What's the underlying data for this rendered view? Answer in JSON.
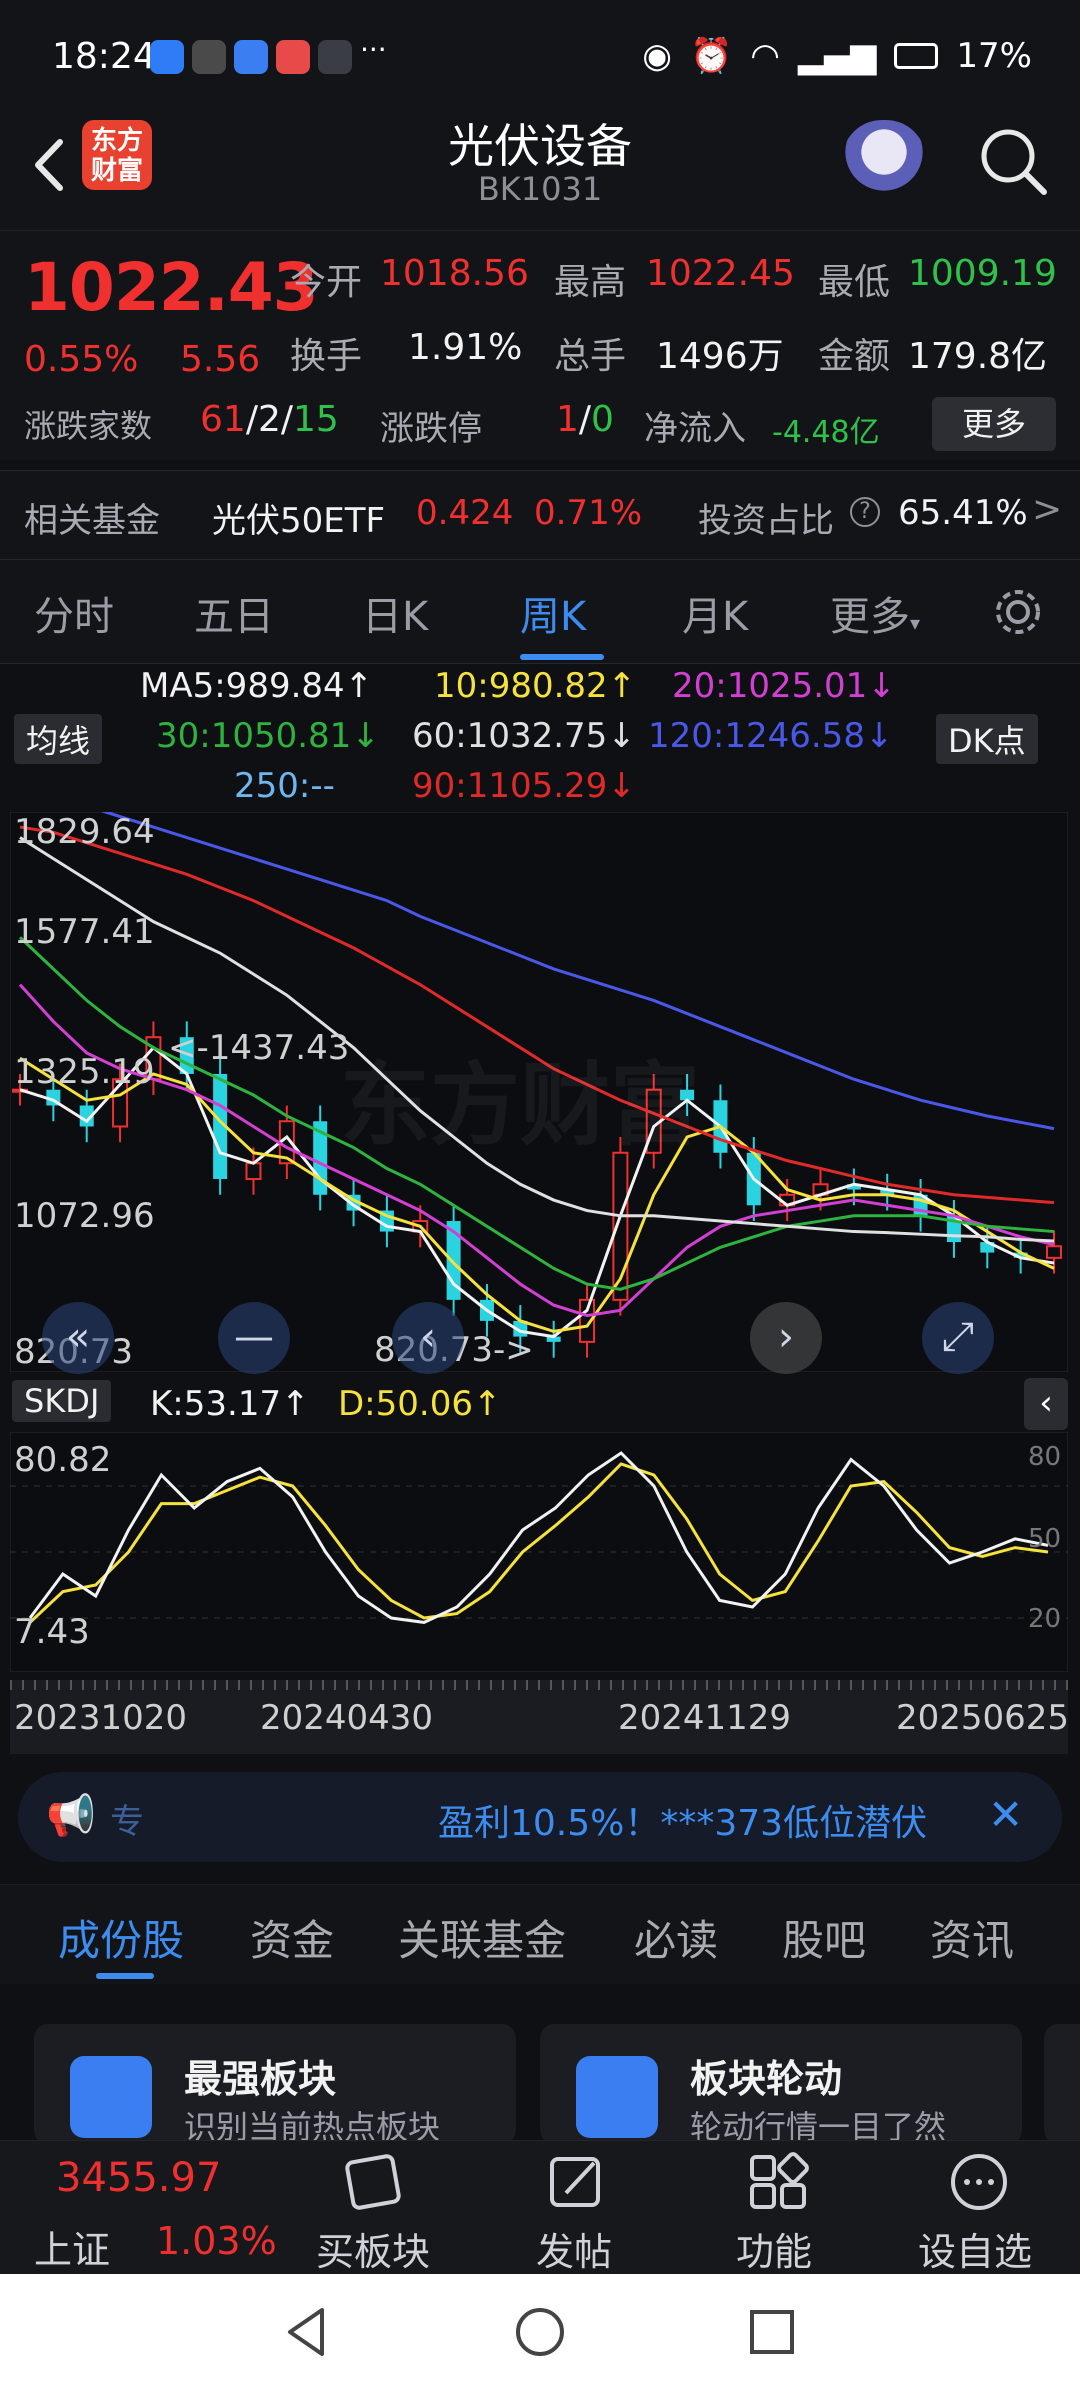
{
  "status_bar": {
    "time": "18:24",
    "right_text": "17%",
    "app_icon_colors": [
      "#2f7df6",
      "#4a4a4a",
      "#3a7ef2",
      "#e84a4a",
      "#3a3d45"
    ]
  },
  "header": {
    "logo_text": "东方财富",
    "title": "光伏设备",
    "code": "BK1031",
    "icons": [
      "back-icon",
      "robot-avatar",
      "search-icon"
    ]
  },
  "quote": {
    "price": "1022.43",
    "change_pct": "0.55%",
    "change_abs": "5.56",
    "open_label": "今开",
    "open_value": "1018.56",
    "high_label": "最高",
    "high_value": "1022.45",
    "low_label": "最低",
    "low_value": "1009.19",
    "turnover_label": "换手",
    "turnover_value": "1.91%",
    "volume_label": "总手",
    "volume_value": "1496万",
    "amount_label": "金额",
    "amount_value": "179.8亿",
    "updown_label": "涨跌家数",
    "up_count": "61",
    "flat_count": "2",
    "down_count": "15",
    "limit_label": "涨跌停",
    "limit_up": "1",
    "limit_down": "0",
    "netflow_label": "净流入",
    "netflow_value": "-4.48亿",
    "more_button": "更多"
  },
  "fund": {
    "label": "相关基金",
    "name": "光伏50ETF",
    "price": "0.424",
    "pct": "0.71%",
    "ratio_label": "投资占比",
    "ratio_value": "65.41%"
  },
  "kline_tabs": [
    "分时",
    "五日",
    "日K",
    "周K",
    "月K",
    "更多"
  ],
  "kline_tab_active": "周K",
  "ma_legend": {
    "toggle": "均线",
    "dk": "DK点",
    "items": [
      {
        "text": "MA5:989.84↑",
        "color": "#f2f2f2"
      },
      {
        "text": "10:980.82↑",
        "color": "#f5e23c"
      },
      {
        "text": "20:1025.01↓",
        "color": "#d33fd2"
      },
      {
        "text": "30:1050.81↓",
        "color": "#2fb33f"
      },
      {
        "text": "60:1032.75↓",
        "color": "#e0e0e0"
      },
      {
        "text": "120:1246.58↓",
        "color": "#4a58e8"
      },
      {
        "text": "250:--",
        "color": "#6fb6ef"
      },
      {
        "text": "90:1105.29↓",
        "color": "#e02a2a"
      }
    ]
  },
  "main_chart": {
    "y_labels": [
      "1829.64",
      "1577.41",
      "1325.19",
      "1072.96",
      "820.73"
    ],
    "max_annotation": "<-1437.43",
    "min_annotation": "820.73->",
    "watermark": "东方财富"
  },
  "chart_data": {
    "type": "line",
    "x_tick_labels": [
      "20231020",
      "20240430",
      "20241129",
      "20250625"
    ],
    "ylim": [
      820.73,
      1829.64
    ],
    "series": [
      {
        "name": "MA5",
        "color": "#f2f2f2",
        "values": [
          1320,
          1300,
          1260,
          1330,
          1400,
          1350,
          1200,
          1180,
          1230,
          1150,
          1100,
          1060,
          1050,
          950,
          900,
          860,
          850,
          900,
          1080,
          1250,
          1300,
          1250,
          1150,
          1100,
          1120,
          1140,
          1130,
          1120,
          1080,
          1030,
          1000,
          990
        ]
      },
      {
        "name": "10",
        "color": "#f5e23c",
        "values": [
          1380,
          1340,
          1300,
          1310,
          1350,
          1330,
          1260,
          1200,
          1190,
          1150,
          1110,
          1080,
          1060,
          990,
          930,
          880,
          860,
          870,
          960,
          1120,
          1230,
          1250,
          1200,
          1130,
          1110,
          1120,
          1120,
          1110,
          1090,
          1050,
          1010,
          980
        ]
      },
      {
        "name": "20",
        "color": "#d33fd2",
        "values": [
          1520,
          1450,
          1390,
          1360,
          1340,
          1320,
          1290,
          1250,
          1210,
          1180,
          1150,
          1120,
          1090,
          1050,
          1000,
          950,
          910,
          890,
          900,
          960,
          1020,
          1060,
          1080,
          1090,
          1100,
          1110,
          1100,
          1090,
          1080,
          1060,
          1040,
          1025
        ]
      },
      {
        "name": "30",
        "color": "#2fb33f",
        "values": [
          1610,
          1550,
          1490,
          1440,
          1400,
          1370,
          1340,
          1310,
          1270,
          1240,
          1210,
          1170,
          1140,
          1100,
          1060,
          1020,
          980,
          950,
          940,
          960,
          990,
          1020,
          1040,
          1060,
          1070,
          1080,
          1080,
          1080,
          1070,
          1060,
          1055,
          1050
        ]
      },
      {
        "name": "60",
        "color": "#e0e0e0",
        "values": [
          1800,
          1760,
          1720,
          1680,
          1640,
          1610,
          1580,
          1540,
          1500,
          1450,
          1400,
          1340,
          1280,
          1230,
          1180,
          1140,
          1110,
          1090,
          1080,
          1080,
          1075,
          1070,
          1065,
          1060,
          1055,
          1050,
          1048,
          1045,
          1042,
          1040,
          1035,
          1032
        ]
      },
      {
        "name": "90",
        "color": "#e02a2a",
        "values": [
          1820,
          1810,
          1790,
          1770,
          1750,
          1730,
          1705,
          1680,
          1650,
          1620,
          1590,
          1555,
          1520,
          1480,
          1440,
          1400,
          1360,
          1330,
          1300,
          1275,
          1250,
          1225,
          1205,
          1185,
          1170,
          1155,
          1140,
          1130,
          1120,
          1115,
          1110,
          1105
        ]
      },
      {
        "name": "120",
        "color": "#4a58e8",
        "values": [
          1900,
          1880,
          1860,
          1840,
          1820,
          1800,
          1780,
          1760,
          1740,
          1720,
          1700,
          1680,
          1650,
          1625,
          1600,
          1575,
          1550,
          1530,
          1510,
          1490,
          1465,
          1440,
          1415,
          1390,
          1365,
          1340,
          1320,
          1300,
          1285,
          1270,
          1258,
          1246
        ]
      }
    ],
    "candles_close": [
      1320,
      1290,
      1250,
      1340,
      1420,
      1350,
      1150,
      1180,
      1260,
      1120,
      1090,
      1050,
      1070,
      920,
      880,
      850,
      840,
      920,
      1200,
      1320,
      1300,
      1200,
      1100,
      1120,
      1140,
      1130,
      1120,
      1080,
      1030,
      1010,
      1000,
      1022
    ]
  },
  "skdj": {
    "label": "SKDJ",
    "k_text": "K:53.17↑",
    "d_text": "D:50.06↑",
    "y_left_top": "80.82",
    "y_left_bottom": "7.43",
    "y_right": [
      "80",
      "50",
      "20"
    ],
    "k_values": [
      20,
      40,
      30,
      60,
      85,
      70,
      82,
      88,
      75,
      50,
      30,
      20,
      18,
      25,
      40,
      60,
      70,
      85,
      95,
      80,
      50,
      28,
      25,
      40,
      70,
      92,
      80,
      60,
      45,
      50,
      56,
      53
    ],
    "d_values": [
      18,
      32,
      35,
      50,
      72,
      72,
      78,
      84,
      80,
      62,
      42,
      28,
      20,
      22,
      32,
      50,
      62,
      75,
      90,
      85,
      65,
      40,
      28,
      32,
      55,
      80,
      82,
      68,
      52,
      48,
      52,
      50
    ]
  },
  "banner": {
    "left_text": "专",
    "text": "盈利10.5%！***373低位潜伏"
  },
  "bottom_tabs": [
    "成份股",
    "资金",
    "关联基金",
    "必读",
    "股吧",
    "资讯"
  ],
  "bottom_tab_active": "成份股",
  "cards": [
    {
      "title": "最强板块",
      "sub": "识别当前热点板块"
    },
    {
      "title": "板块轮动",
      "sub": "轮动行情一目了然"
    }
  ],
  "bottom_nav": {
    "index_value": "3455.97",
    "index_name": "上证",
    "index_pct": "1.03%",
    "items": [
      "买板块",
      "发帖",
      "功能",
      "设自选"
    ]
  }
}
